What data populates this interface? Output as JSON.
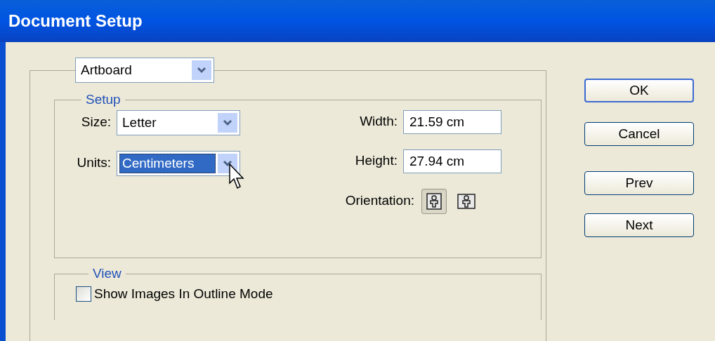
{
  "window": {
    "title": "Document Setup"
  },
  "panel_selector": {
    "value": "Artboard"
  },
  "setup": {
    "legend": "Setup",
    "size": {
      "label": "Size:",
      "value": "Letter",
      "highlighted": false
    },
    "units": {
      "label": "Units:",
      "value": "Centimeters",
      "highlighted": true
    },
    "width": {
      "label": "Width:",
      "value": "21.59 cm"
    },
    "height": {
      "label": "Height:",
      "value": "27.94 cm"
    },
    "orientation": {
      "label": "Orientation:",
      "options": [
        {
          "kind": "portrait",
          "selected": true
        },
        {
          "kind": "landscape",
          "selected": false
        }
      ]
    }
  },
  "view": {
    "legend": "View",
    "show_images_in_outline": {
      "label": "Show Images In Outline Mode",
      "checked": false
    }
  },
  "buttons": [
    {
      "label": "OK",
      "default": true
    },
    {
      "label": "Cancel",
      "default": false
    },
    {
      "label": "Prev",
      "default": false
    },
    {
      "label": "Next",
      "default": false
    }
  ]
}
